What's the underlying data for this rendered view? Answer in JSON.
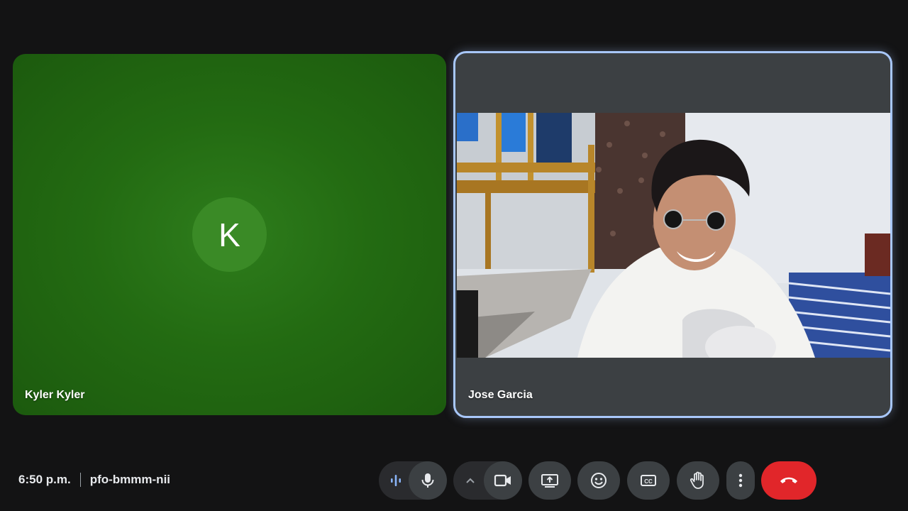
{
  "participants": [
    {
      "name": "Kyler Kyler",
      "avatar_initial": "K",
      "camera_on": false,
      "tile_color": "#236b12"
    },
    {
      "name": "Jose Garcia",
      "camera_on": true,
      "active_speaker": true
    }
  ],
  "footer": {
    "time": "6:50 p.m.",
    "meeting_code": "pfo-bmmm-nii"
  },
  "controls": [
    {
      "icon": "audio-level-icon"
    },
    {
      "icon": "microphone-icon"
    },
    {
      "icon": "chevron-up-icon"
    },
    {
      "icon": "camera-icon"
    },
    {
      "icon": "present-screen-icon"
    },
    {
      "icon": "emoji-icon"
    },
    {
      "icon": "captions-icon"
    },
    {
      "icon": "raise-hand-icon"
    },
    {
      "icon": "more-options-icon"
    },
    {
      "icon": "hang-up-icon"
    }
  ],
  "colors": {
    "background": "#131314",
    "active_border": "#a8c7fa",
    "hangup": "#e1262a",
    "audio_indicator": "#8ab4f8"
  }
}
